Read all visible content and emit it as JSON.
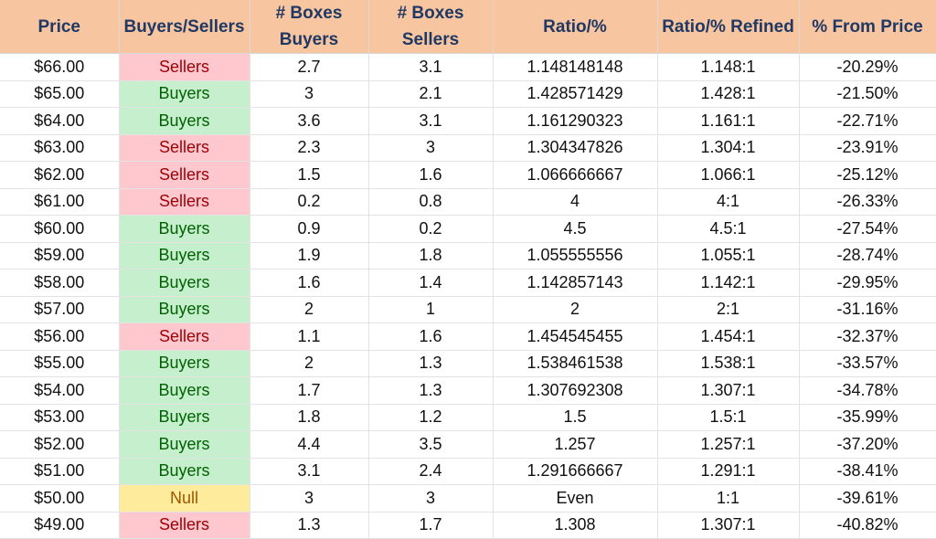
{
  "columns": [
    "Price",
    "Buyers/Sellers",
    "# Boxes\nBuyers",
    "# Boxes\nSellers",
    "Ratio/%",
    "Ratio/% Refined",
    "% From Price"
  ],
  "column_lines": [
    [
      "Price"
    ],
    [
      "Buyers/Sellers"
    ],
    [
      "# Boxes",
      "Buyers"
    ],
    [
      "# Boxes",
      "Sellers"
    ],
    [
      "Ratio/%"
    ],
    [
      "Ratio/% Refined"
    ],
    [
      "% From Price"
    ]
  ],
  "colors": {
    "header_bg": "#f7c59f",
    "header_text": "#1f3864",
    "buyers_bg": "#c6efce",
    "buyers_text": "#006100",
    "sellers_bg": "#ffc7ce",
    "sellers_text": "#9c0006",
    "null_bg": "#ffeb9c",
    "null_text": "#9c5700"
  },
  "rows": [
    [
      "$66.00",
      "Sellers",
      "2.7",
      "3.1",
      "1.148148148",
      "1.148:1",
      "-20.29%"
    ],
    [
      "$65.00",
      "Buyers",
      "3",
      "2.1",
      "1.428571429",
      "1.428:1",
      "-21.50%"
    ],
    [
      "$64.00",
      "Buyers",
      "3.6",
      "3.1",
      "1.161290323",
      "1.161:1",
      "-22.71%"
    ],
    [
      "$63.00",
      "Sellers",
      "2.3",
      "3",
      "1.304347826",
      "1.304:1",
      "-23.91%"
    ],
    [
      "$62.00",
      "Sellers",
      "1.5",
      "1.6",
      "1.066666667",
      "1.066:1",
      "-25.12%"
    ],
    [
      "$61.00",
      "Sellers",
      "0.2",
      "0.8",
      "4",
      "4:1",
      "-26.33%"
    ],
    [
      "$60.00",
      "Buyers",
      "0.9",
      "0.2",
      "4.5",
      "4.5:1",
      "-27.54%"
    ],
    [
      "$59.00",
      "Buyers",
      "1.9",
      "1.8",
      "1.055555556",
      "1.055:1",
      "-28.74%"
    ],
    [
      "$58.00",
      "Buyers",
      "1.6",
      "1.4",
      "1.142857143",
      "1.142:1",
      "-29.95%"
    ],
    [
      "$57.00",
      "Buyers",
      "2",
      "1",
      "2",
      "2:1",
      "-31.16%"
    ],
    [
      "$56.00",
      "Sellers",
      "1.1",
      "1.6",
      "1.454545455",
      "1.454:1",
      "-32.37%"
    ],
    [
      "$55.00",
      "Buyers",
      "2",
      "1.3",
      "1.538461538",
      "1.538:1",
      "-33.57%"
    ],
    [
      "$54.00",
      "Buyers",
      "1.7",
      "1.3",
      "1.307692308",
      "1.307:1",
      "-34.78%"
    ],
    [
      "$53.00",
      "Buyers",
      "1.8",
      "1.2",
      "1.5",
      "1.5:1",
      "-35.99%"
    ],
    [
      "$52.00",
      "Buyers",
      "4.4",
      "3.5",
      "1.257",
      "1.257:1",
      "-37.20%"
    ],
    [
      "$51.00",
      "Buyers",
      "3.1",
      "2.4",
      "1.291666667",
      "1.291:1",
      "-38.41%"
    ],
    [
      "$50.00",
      "Null",
      "3",
      "3",
      "Even",
      "1:1",
      "-39.61%"
    ],
    [
      "$49.00",
      "Sellers",
      "1.3",
      "1.7",
      "1.308",
      "1.307:1",
      "-40.82%"
    ]
  ]
}
